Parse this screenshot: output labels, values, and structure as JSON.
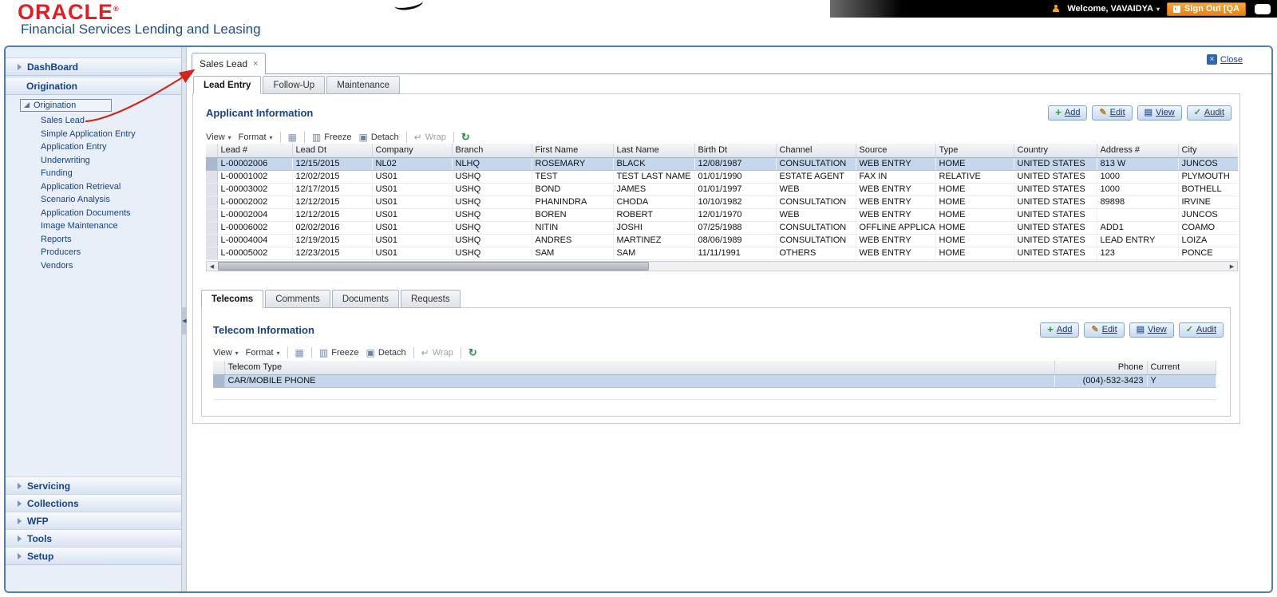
{
  "header": {
    "logo": "ORACLE",
    "logo_reg": "®",
    "subtitle": "Financial Services Lending and Leasing",
    "welcome": "Welcome, VAVAIDYA",
    "sign_out": "Sign Out [QA",
    "colors": {
      "oracle_red": "#e01e23",
      "subtitle_blue": "#1b4e8c",
      "signout_orange": "#f39416",
      "frame_blue": "#4d7cc0",
      "selected_row": "#c5d7ec"
    }
  },
  "sidebar": {
    "dashboard": "DashBoard",
    "origination_header": "Origination",
    "tree_root": "Origination",
    "tree_items": [
      "Sales Lead",
      "Simple Application Entry",
      "Application Entry",
      "Underwriting",
      "Funding",
      "Application Retrieval",
      "Scenario Analysis",
      "Application Documents",
      "Image Maintenance",
      "Reports",
      "Producers",
      "Vendors"
    ],
    "sections": [
      "Servicing",
      "Collections",
      "WFP",
      "Tools",
      "Setup"
    ]
  },
  "workspace": {
    "open_tab": "Sales Lead",
    "tab_close": "×",
    "close_label": "Close",
    "subtabs": [
      {
        "label": "Lead Entry",
        "active": true
      },
      {
        "label": "Follow-Up",
        "active": false
      },
      {
        "label": "Maintenance",
        "active": false
      }
    ]
  },
  "toolbar": {
    "view": "View",
    "format": "Format",
    "freeze": "Freeze",
    "detach": "Detach",
    "wrap": "Wrap"
  },
  "actions": [
    {
      "label": "Add",
      "icon": "add"
    },
    {
      "label": "Edit",
      "icon": "edit"
    },
    {
      "label": "View",
      "icon": "view"
    },
    {
      "label": "Audit",
      "icon": "audit"
    }
  ],
  "applicant": {
    "title": "Applicant Information",
    "columns": [
      "Lead #",
      "Lead Dt",
      "Company",
      "Branch",
      "First Name",
      "Last Name",
      "Birth Dt",
      "Channel",
      "Source",
      "Type",
      "Country",
      "Address #",
      "City"
    ],
    "rows": [
      [
        "L-00002006",
        "12/15/2015",
        "NL02",
        "NLHQ",
        "ROSEMARY",
        "BLACK",
        "12/08/1987",
        "CONSULTATION",
        "WEB ENTRY",
        "HOME",
        "UNITED STATES",
        "813 W",
        "JUNCOS"
      ],
      [
        "L-00001002",
        "12/02/2015",
        "US01",
        "USHQ",
        "TEST",
        "TEST LAST NAME",
        "01/01/1990",
        "ESTATE AGENT",
        "FAX IN",
        "RELATIVE",
        "UNITED STATES",
        "1000",
        "PLYMOUTH"
      ],
      [
        "L-00003002",
        "12/17/2015",
        "US01",
        "USHQ",
        "BOND",
        "JAMES",
        "01/01/1997",
        "WEB",
        "WEB ENTRY",
        "HOME",
        "UNITED STATES",
        "1000",
        "BOTHELL"
      ],
      [
        "L-00002002",
        "12/12/2015",
        "US01",
        "USHQ",
        "PHANINDRA",
        "CHODA",
        "10/10/1982",
        "CONSULTATION",
        "WEB ENTRY",
        "HOME",
        "UNITED STATES",
        "89898",
        "IRVINE"
      ],
      [
        "L-00002004",
        "12/12/2015",
        "US01",
        "USHQ",
        "BOREN",
        "ROBERT",
        "12/01/1970",
        "WEB",
        "WEB ENTRY",
        "HOME",
        "UNITED STATES",
        "",
        "JUNCOS"
      ],
      [
        "L-00006002",
        "02/02/2016",
        "US01",
        "USHQ",
        "NITIN",
        "JOSHI",
        "07/25/1988",
        "CONSULTATION",
        "OFFLINE APPLICA...",
        "HOME",
        "UNITED STATES",
        "ADD1",
        "COAMO"
      ],
      [
        "L-00004004",
        "12/19/2015",
        "US01",
        "USHQ",
        "ANDRES",
        "MARTINEZ",
        "08/06/1989",
        "CONSULTATION",
        "WEB ENTRY",
        "HOME",
        "UNITED STATES",
        "LEAD ENTRY",
        "LOIZA"
      ],
      [
        "L-00005002",
        "12/23/2015",
        "US01",
        "USHQ",
        "SAM",
        "SAM",
        "11/11/1991",
        "OTHERS",
        "WEB ENTRY",
        "HOME",
        "UNITED STATES",
        "123",
        "PONCE"
      ]
    ],
    "selected_row": 0
  },
  "detail_tabs": [
    {
      "label": "Telecoms",
      "active": true
    },
    {
      "label": "Comments",
      "active": false
    },
    {
      "label": "Documents",
      "active": false
    },
    {
      "label": "Requests",
      "active": false
    }
  ],
  "telecom": {
    "title": "Telecom Information",
    "columns": [
      "Telecom Type",
      "Phone",
      "Current"
    ],
    "rows": [
      [
        "CAR/MOBILE PHONE",
        "(004)-532-3423",
        "Y"
      ]
    ],
    "selected_row": 0
  }
}
